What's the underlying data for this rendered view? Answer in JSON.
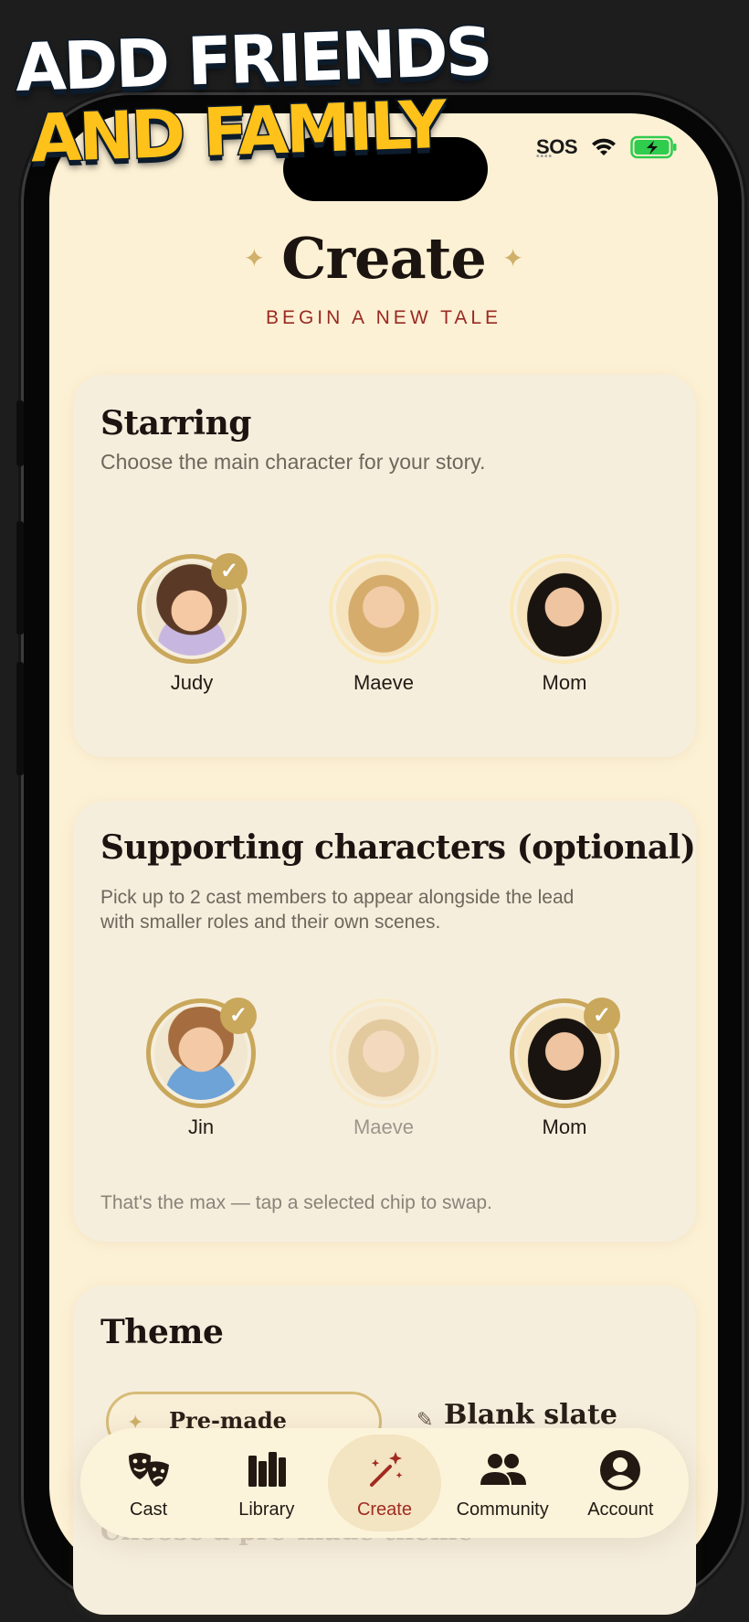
{
  "promo": {
    "line1": "ADD FRIENDS",
    "line2": "AND FAMILY"
  },
  "status_bar": {
    "carrier": "SOS",
    "wifi_icon": "wifi-icon",
    "battery_icon": "battery-charging-icon",
    "battery_color": "#2fcc4d"
  },
  "header": {
    "title": "Create",
    "subtitle": "BEGIN A NEW TALE",
    "sparkle_color": "#d0b06a"
  },
  "starring": {
    "title": "Starring",
    "description": "Choose the main character for your story.",
    "cast": [
      {
        "name": "Judy",
        "selected": true
      },
      {
        "name": "Maeve",
        "selected": false
      },
      {
        "name": "Mom",
        "selected": false
      }
    ]
  },
  "supporting": {
    "title": "Supporting characters (optional)",
    "description_line1": "Pick up to 2 cast members to appear alongside the lead",
    "description_line2": "with smaller roles and their own scenes.",
    "cast": [
      {
        "name": "Jin",
        "selected": true
      },
      {
        "name": "Maeve",
        "selected": false,
        "dimmed": true
      },
      {
        "name": "Mom",
        "selected": true
      }
    ],
    "footer": "That's the max — tap a selected chip to swap."
  },
  "theme": {
    "title": "Theme",
    "options": [
      {
        "label": "Pre-made themes",
        "selected": true
      },
      {
        "label": "Blank slate",
        "selected": false
      }
    ],
    "next_label_partial": "Choose a pre-made theme"
  },
  "tabbar": {
    "items": [
      {
        "label": "Cast",
        "icon": "theater-masks-icon"
      },
      {
        "label": "Library",
        "icon": "books-icon"
      },
      {
        "label": "Create",
        "icon": "magic-wand-icon",
        "active": true
      },
      {
        "label": "Community",
        "icon": "people-icon"
      },
      {
        "label": "Account",
        "icon": "account-icon"
      }
    ],
    "active_color": "#a12b21"
  },
  "colors": {
    "screen_bg": "#fdf1d5",
    "card_bg": "#f6eedd",
    "accent_gold": "#c9a75b",
    "accent_red": "#9a2a22"
  }
}
